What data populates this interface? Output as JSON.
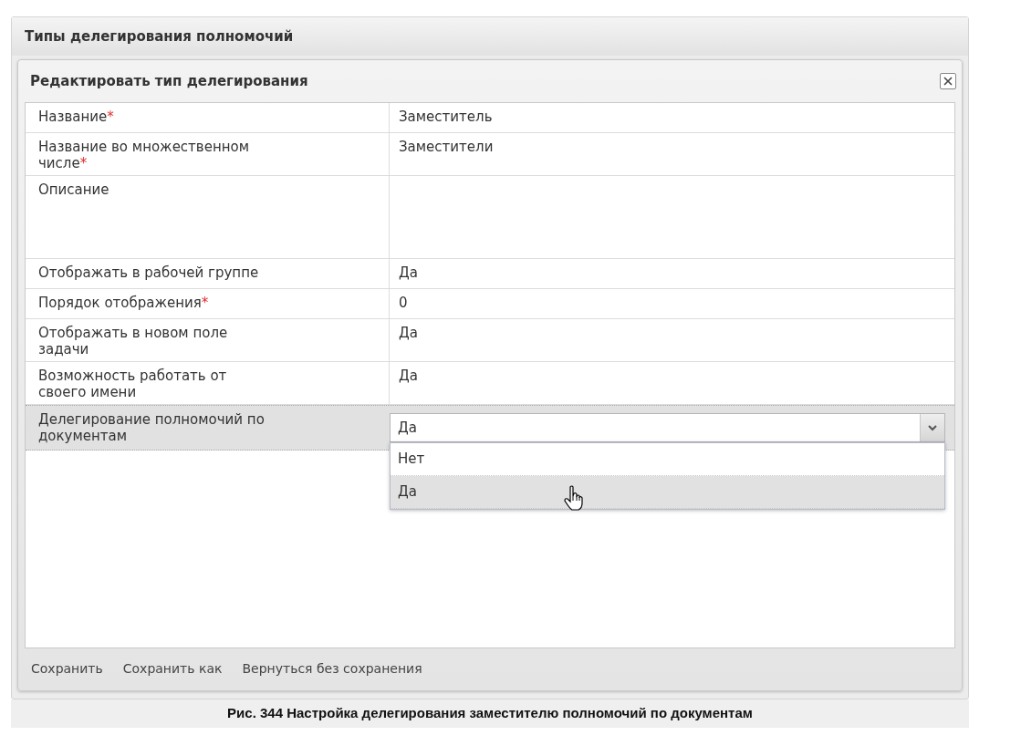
{
  "panel": {
    "title": "Типы делегирования полномочий"
  },
  "dialog": {
    "title": "Редактировать тип делегирования",
    "rows": [
      {
        "kind": "text",
        "label": "Название",
        "required_mark": "*",
        "value": "Заместитель"
      },
      {
        "kind": "text",
        "label": "Название во множественном числе",
        "required_mark": "*",
        "value": "Заместители"
      },
      {
        "kind": "textarea",
        "label": "Описание"
      },
      {
        "kind": "text",
        "label": "Отображать в рабочей группе",
        "value": "Да"
      },
      {
        "kind": "text",
        "label": "Порядок отображения",
        "required_mark": "*",
        "value": "0"
      },
      {
        "kind": "text",
        "label": "Отображать в новом поле задачи",
        "value": "Да"
      },
      {
        "kind": "text",
        "label": "Возможность работать от своего имени",
        "value": "Да"
      },
      {
        "kind": "select",
        "label": "Делегирование полномочий по документам",
        "value": "Да",
        "expanded": true,
        "options": [
          {
            "label": "Нет",
            "selected": false
          },
          {
            "label": "Да",
            "selected": true
          }
        ]
      }
    ],
    "buttons": [
      "Сохранить",
      "Сохранить как",
      "Вернуться без сохранения"
    ]
  },
  "caption": "Рис. 344 Настройка делегирования заместителю полномочий по документам"
}
